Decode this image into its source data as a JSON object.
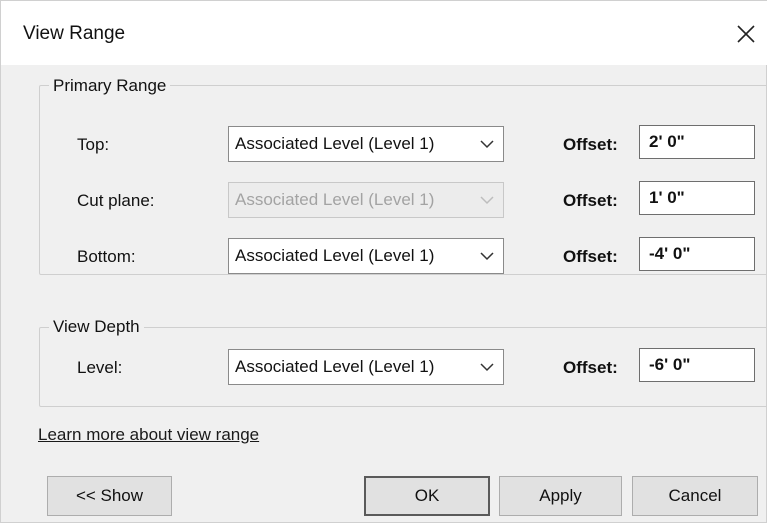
{
  "window": {
    "title": "View Range",
    "close_icon": "close-icon"
  },
  "primary_range": {
    "legend": "Primary Range",
    "rows": [
      {
        "label": "Top:",
        "select_value": "Associated Level (Level 1)",
        "enabled": true,
        "offset_label": "Offset:",
        "offset_value": "2' 0\""
      },
      {
        "label": "Cut plane:",
        "select_value": "Associated Level (Level 1)",
        "enabled": false,
        "offset_label": "Offset:",
        "offset_value": "1' 0\""
      },
      {
        "label": "Bottom:",
        "select_value": "Associated Level (Level 1)",
        "enabled": true,
        "offset_label": "Offset:",
        "offset_value": "-4' 0\""
      }
    ]
  },
  "view_depth": {
    "legend": "View Depth",
    "rows": [
      {
        "label": "Level:",
        "select_value": "Associated Level (Level 1)",
        "enabled": true,
        "offset_label": "Offset:",
        "offset_value": "-6' 0\""
      }
    ]
  },
  "learn_more_link": "Learn more about view range",
  "buttons": {
    "show": "<< Show",
    "ok": "OK",
    "apply": "Apply",
    "cancel": "Cancel"
  },
  "colors": {
    "dialog_bg": "#f0f0f0",
    "titlebar_bg": "#ffffff",
    "disabled_text": "#a3a3a3"
  }
}
